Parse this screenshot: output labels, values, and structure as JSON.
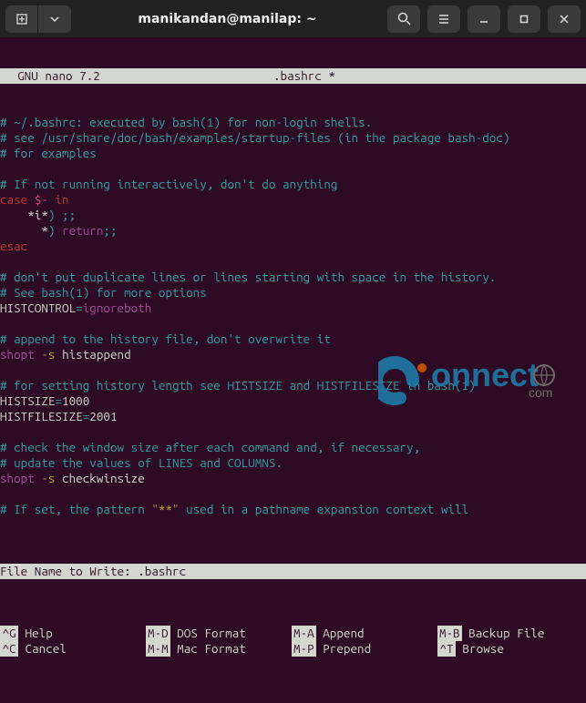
{
  "titlebar": {
    "title": "manikandan@manilap: ~"
  },
  "nano": {
    "version": "  GNU nano 7.2",
    "filename": ".bashrc *"
  },
  "lines": [
    [
      [
        "c-comment",
        "# ~/.bashrc: executed by bash(1) for non-login shells."
      ]
    ],
    [
      [
        "c-comment",
        "# see /usr/share/doc/bash/examples/startup-files (in the package bash-doc)"
      ]
    ],
    [
      [
        "c-comment",
        "# for examples"
      ]
    ],
    [
      [
        "",
        ""
      ]
    ],
    [
      [
        "c-comment",
        "# If not running interactively, don't do anything"
      ]
    ],
    [
      [
        "c-kw",
        "case "
      ],
      [
        "c-var",
        "$-"
      ],
      [
        "c-kw",
        " in"
      ]
    ],
    [
      [
        "",
        "    *i*"
      ],
      [
        "c-op",
        ") ;;"
      ]
    ],
    [
      [
        "",
        "      *"
      ],
      [
        "c-op",
        ") "
      ],
      [
        "c-kw2",
        "return"
      ],
      [
        "c-op",
        ";;"
      ]
    ],
    [
      [
        "c-kw",
        "esac"
      ]
    ],
    [
      [
        "",
        ""
      ]
    ],
    [
      [
        "c-comment",
        "# don't put duplicate lines or lines starting with space in the history."
      ]
    ],
    [
      [
        "c-comment",
        "# See bash(1) for more options"
      ]
    ],
    [
      [
        "",
        "HISTCONTROL"
      ],
      [
        "c-op",
        "="
      ],
      [
        "c-kw2",
        "ignoreboth"
      ]
    ],
    [
      [
        "",
        ""
      ]
    ],
    [
      [
        "c-comment",
        "# append to the history file, don't overwrite it"
      ]
    ],
    [
      [
        "c-kw2",
        "shopt "
      ],
      [
        "c-arg",
        "-s "
      ],
      [
        "",
        "histappend"
      ]
    ],
    [
      [
        "",
        ""
      ]
    ],
    [
      [
        "c-comment",
        "# for setting history length see HISTSIZE and HISTFILESIZE in bash(1)"
      ]
    ],
    [
      [
        "",
        "HISTSIZE"
      ],
      [
        "c-op",
        "="
      ],
      [
        "",
        "1000"
      ]
    ],
    [
      [
        "",
        "HISTFILESIZE"
      ],
      [
        "c-op",
        "="
      ],
      [
        "",
        "2001"
      ]
    ],
    [
      [
        "",
        ""
      ]
    ],
    [
      [
        "c-comment",
        "# check the window size after each command and, if necessary,"
      ]
    ],
    [
      [
        "c-comment",
        "# update the values of LINES and COLUMNS."
      ]
    ],
    [
      [
        "c-kw2",
        "shopt "
      ],
      [
        "c-arg",
        "-s "
      ],
      [
        "",
        "checkwinsize"
      ]
    ],
    [
      [
        "",
        ""
      ]
    ],
    [
      [
        "c-comment",
        "# If set, the pattern "
      ],
      [
        "c-q",
        "\"**\""
      ],
      [
        "c-comment",
        " used in a pathname expansion context will"
      ]
    ]
  ],
  "prompt": {
    "label": "File Name to Write: ",
    "value": ".bashrc"
  },
  "help": [
    [
      {
        "k": "^G",
        "l": " Help"
      },
      {
        "k": "M-D",
        "l": " DOS Format"
      },
      {
        "k": "M-A",
        "l": " Append"
      },
      {
        "k": "M-B",
        "l": " Backup File"
      }
    ],
    [
      {
        "k": "^C",
        "l": " Cancel"
      },
      {
        "k": "M-M",
        "l": " Mac Format"
      },
      {
        "k": "M-P",
        "l": " Prepend"
      },
      {
        "k": "^T",
        "l": " Browse"
      }
    ]
  ],
  "watermark": {
    "text": "onnect",
    "sub": "com"
  }
}
